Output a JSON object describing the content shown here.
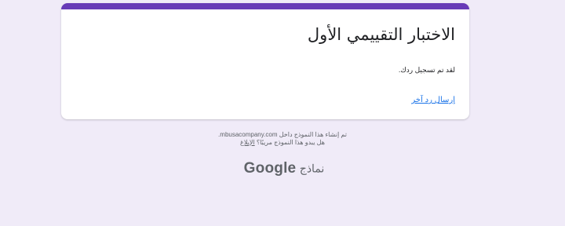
{
  "form": {
    "title": "الاختبار التقييمي الأول",
    "confirmation": "لقد تم تسجيل ردك.",
    "resubmit_link": "إرسال رد آخر"
  },
  "footer": {
    "created_in": "تم إنشاء هذا النموذج داخل mbusacompany.com.",
    "suspicious": "هل يبدو هذا النموذج مريبًا؟",
    "report": "الإبلاغ"
  },
  "branding": {
    "google": "Google",
    "forms": "نماذج"
  },
  "colors": {
    "accent": "#673ab7",
    "background": "#f0ebf8",
    "link": "#1a73e8"
  }
}
